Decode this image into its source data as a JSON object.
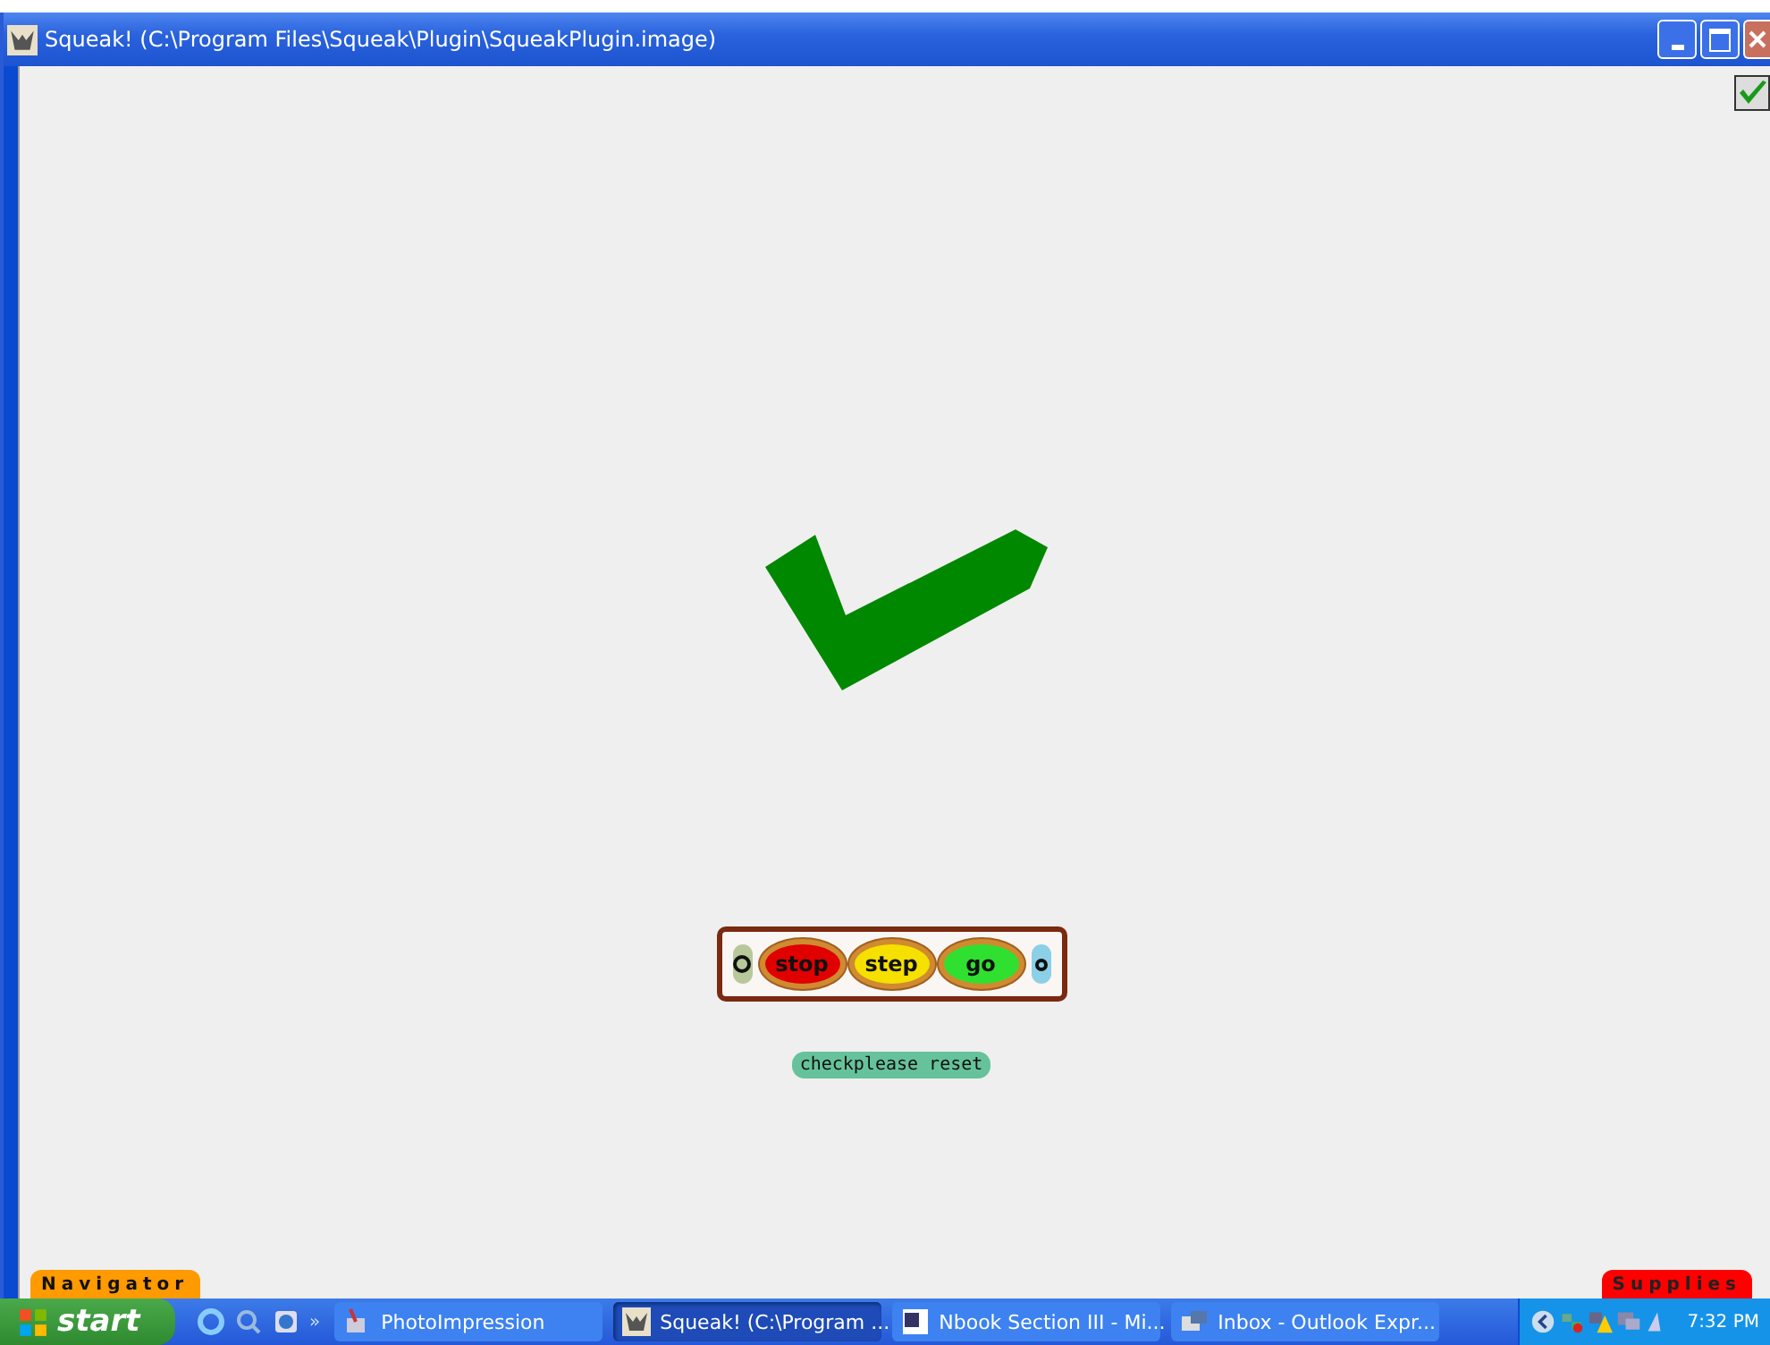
{
  "window": {
    "title": "Squeak! (C:\\Program Files\\Squeak\\Plugin\\SqueakPlugin.image)"
  },
  "controls": {
    "buttons": [
      {
        "label": "stop",
        "kind": "stop"
      },
      {
        "label": "step",
        "kind": "step"
      },
      {
        "label": "go",
        "kind": "go"
      }
    ]
  },
  "script_button": {
    "label": "checkplease reset"
  },
  "flaps": [
    {
      "label": "Navigator",
      "kind": "navigator"
    },
    {
      "label": "Supplies",
      "kind": "supplies"
    }
  ],
  "taskbar": {
    "start": "start",
    "overflow": "»",
    "tasks": [
      {
        "label": "PhotoImpression",
        "selected": false,
        "kind": "photo"
      },
      {
        "label": "Squeak! (C:\\Program ...",
        "selected": true,
        "kind": "squeak"
      },
      {
        "label": "Nbook Section III - Mi...",
        "selected": false,
        "kind": "word"
      },
      {
        "label": "Inbox - Outlook Expr...",
        "selected": false,
        "kind": "mail"
      }
    ],
    "clock": "7:32 PM"
  }
}
